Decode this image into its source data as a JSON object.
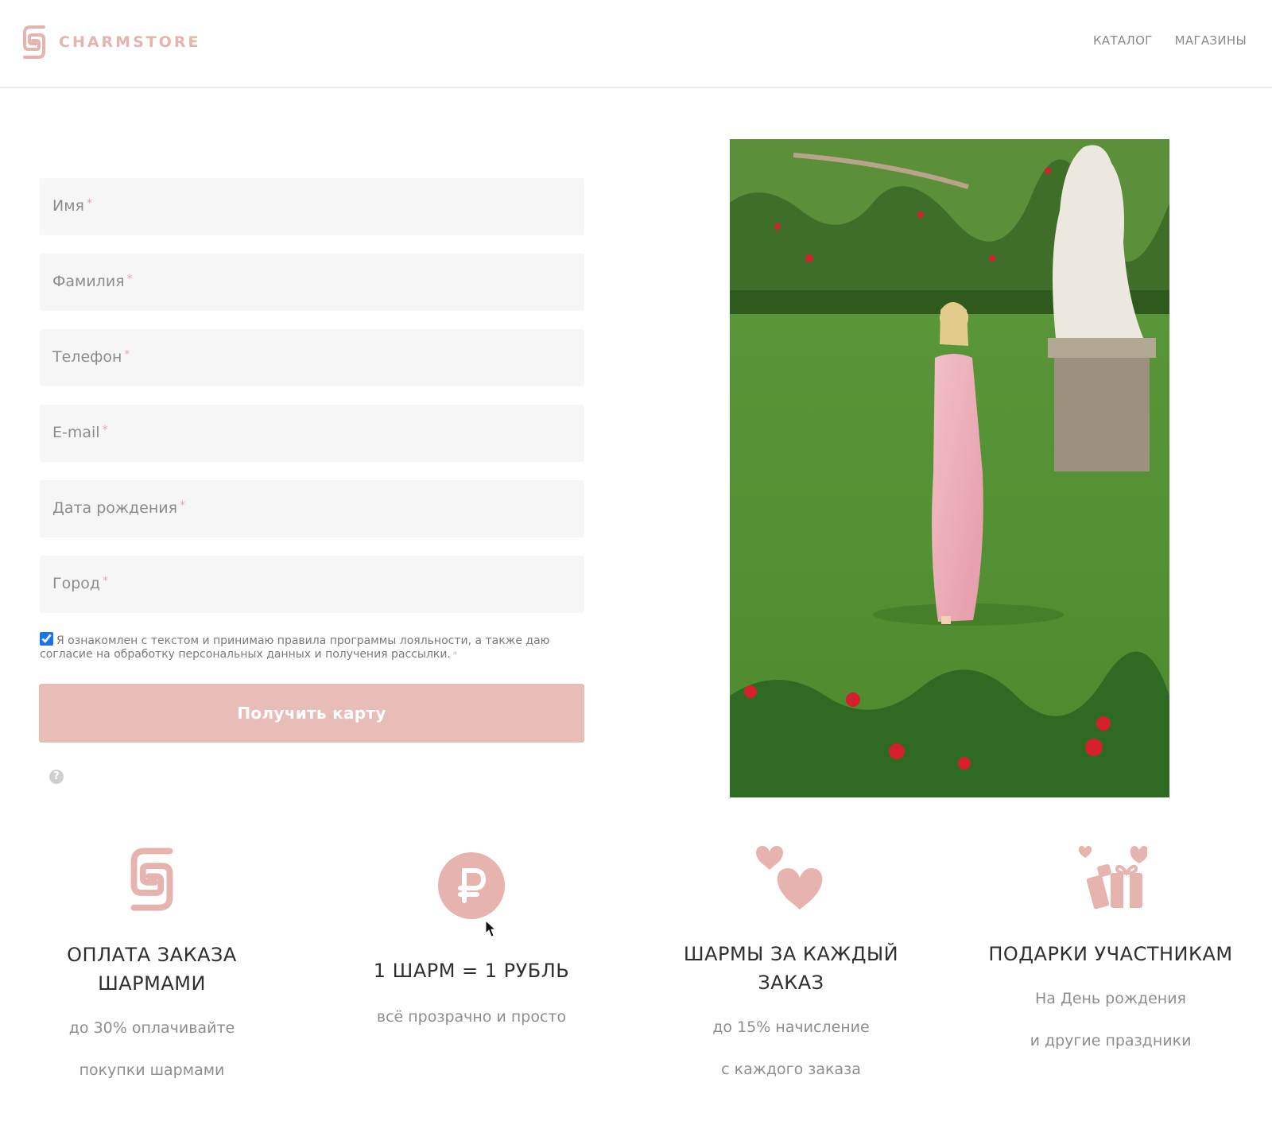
{
  "header": {
    "brand": "CHARMSTORE",
    "nav": [
      {
        "label": "КАТАЛОГ"
      },
      {
        "label": "МАГАЗИНЫ"
      }
    ]
  },
  "form": {
    "fields": [
      {
        "placeholder": "Имя",
        "required_mark": "*",
        "value": ""
      },
      {
        "placeholder": "Фамилия",
        "required_mark": "*",
        "value": ""
      },
      {
        "placeholder": "Телефон",
        "required_mark": "*",
        "value": ""
      },
      {
        "placeholder": "E-mail",
        "required_mark": "*",
        "value": ""
      },
      {
        "placeholder": "Дата рождения",
        "required_mark": "*",
        "value": ""
      },
      {
        "placeholder": "Город",
        "required_mark": "*",
        "value": ""
      }
    ],
    "consent": {
      "checked": true,
      "text": "Я ознакомлен с текстом и принимаю правила программы лояльности, а также даю согласие на обработку персональных данных и получения рассылки.",
      "required_mark": "*"
    },
    "submit_label": "Получить карту",
    "help_icon": "?"
  },
  "features": [
    {
      "icon": "charm-logo-icon",
      "title": "ОПЛАТА ЗАКАЗА ШАРМАМИ",
      "desc_line1": "до 30% оплачивайте",
      "desc_line2": "покупки шармами"
    },
    {
      "icon": "ruble-icon",
      "title": "1 ШАРМ = 1 РУБЛЬ",
      "desc_line1": "всё прозрачно и просто",
      "desc_line2": ""
    },
    {
      "icon": "hearts-icon",
      "title": "ШАРМЫ ЗА КАЖДЫЙ ЗАКАЗ",
      "desc_line1": "до 15% начисление",
      "desc_line2": "с каждого заказа"
    },
    {
      "icon": "gift-icon",
      "title": "ПОДАРКИ УЧАСТНИКАМ",
      "desc_line1": "На День рождения",
      "desc_line2": "и другие праздники"
    }
  ],
  "colors": {
    "accent": "#e6b3ae",
    "button": "#e9bdb7",
    "field_bg": "#f6f6f6"
  }
}
